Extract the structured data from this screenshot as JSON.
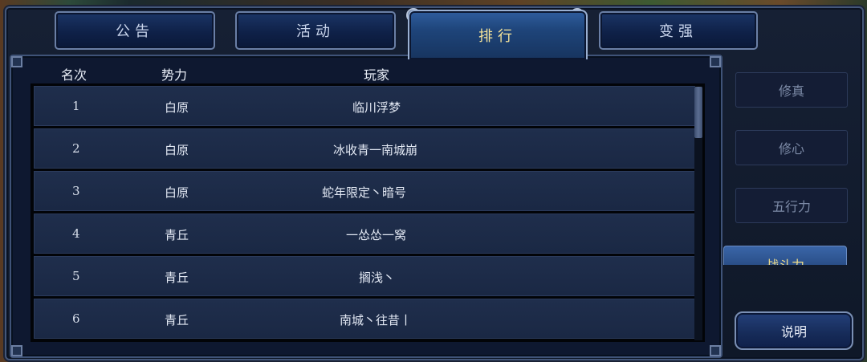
{
  "tabs": [
    {
      "label": "公告",
      "active": false
    },
    {
      "label": "活动",
      "active": false
    },
    {
      "label": "排行",
      "active": true
    },
    {
      "label": "变强",
      "active": false
    }
  ],
  "table": {
    "headers": {
      "rank": "名次",
      "faction": "势力",
      "player": "玩家"
    },
    "rows": [
      {
        "rank": "1",
        "faction": "白原",
        "player": "临川浮梦"
      },
      {
        "rank": "2",
        "faction": "白原",
        "player": "冰收青一南城崩"
      },
      {
        "rank": "3",
        "faction": "白原",
        "player": "蛇年限定丶暗号"
      },
      {
        "rank": "4",
        "faction": "青丘",
        "player": "一怂怂一窝"
      },
      {
        "rank": "5",
        "faction": "青丘",
        "player": "搁浅丶"
      },
      {
        "rank": "6",
        "faction": "青丘",
        "player": "南城丶往昔丨"
      }
    ]
  },
  "sidebar": {
    "items": [
      {
        "label": "修真"
      },
      {
        "label": "修心"
      },
      {
        "label": "五行力"
      },
      {
        "label": "战斗力",
        "active": true
      }
    ],
    "explain_label": "说明"
  },
  "colors": {
    "active_tab_text": "#f4e39a",
    "panel_bg": "#0e1830",
    "row_bg": "#1f2e4c"
  }
}
